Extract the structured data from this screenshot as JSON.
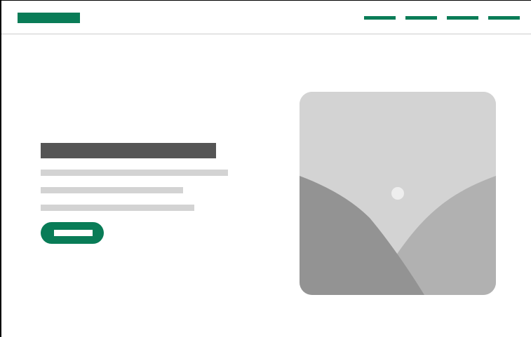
{
  "theme": {
    "accent": "#097c57",
    "title_bar_color": "#555555",
    "text_line_color": "#d3d3d3",
    "image_sky": "#d3d3d3",
    "image_hill_left": "#939393",
    "image_hill_right": "#b1b1b1",
    "image_sun": "#eeeeee"
  },
  "nav": {
    "logo_icon": "logo-placeholder-icon",
    "links": [
      "",
      "",
      "",
      ""
    ]
  },
  "hero": {
    "title": "",
    "body_lines": [
      "",
      "",
      ""
    ],
    "cta_label": ""
  },
  "media": {
    "icon": "image-placeholder-icon"
  }
}
